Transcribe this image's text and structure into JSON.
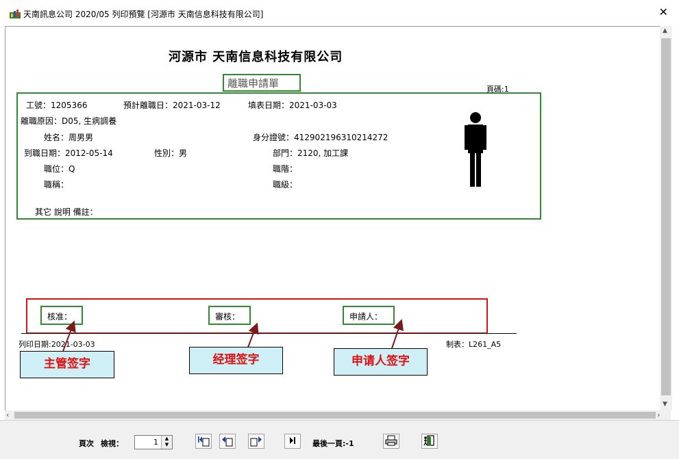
{
  "window": {
    "title": "天南訊息公司 2020/05 列印預覽 [河源市 天南信息科技有限公司]",
    "close_label": "✕"
  },
  "report": {
    "company": "河源市 天南信息科技有限公司",
    "form_title": "離職申請單",
    "page_number": "頁碼:1",
    "employee": {
      "id_label": "工號：",
      "id_value": "1205366",
      "planned_leave_label": "預計離職日：",
      "planned_leave_value": "2021-03-12",
      "fill_date_label": "填表日期：",
      "fill_date_value": "2021-03-03",
      "reason_label": "離職原因：",
      "reason_value": "D05, 生病調養",
      "name_label": "姓名：",
      "name_value": "周男男",
      "idcard_label": "身分證號：",
      "idcard_value": "412902196310214272",
      "join_date_label": "到職日期：",
      "join_date_value": "2012-05-14",
      "gender_label": "性別：",
      "gender_value": "男",
      "dept_label": "部門：",
      "dept_value": "2120, 加工課",
      "position_label": "職位：",
      "position_value": "Q",
      "rank_label": "職階：",
      "rank_value": "",
      "title_label": "職稱：",
      "title_value": "",
      "grade_label": "職級：",
      "grade_value": "",
      "remarks_label": "其它 說明 備註："
    },
    "signatures": {
      "approve_label": "核准：",
      "review_label": "審核：",
      "applicant_label": "申請人："
    },
    "footer": {
      "print_date": "列印日期:2021-03-03",
      "form_code": "制表：L261_A5"
    },
    "annotations": {
      "supervisor": "主管签字",
      "manager": "经理签字",
      "applicant": "申请人签字"
    }
  },
  "toolbar": {
    "page_label": "頁次",
    "view_label": "檢視：",
    "page_value": "1",
    "last_page_label": "最後一頁:-1"
  },
  "colors": {
    "green_frame": "#2e8b2e",
    "red_frame": "#e01010",
    "annotation_bg": "#cfeff7"
  }
}
